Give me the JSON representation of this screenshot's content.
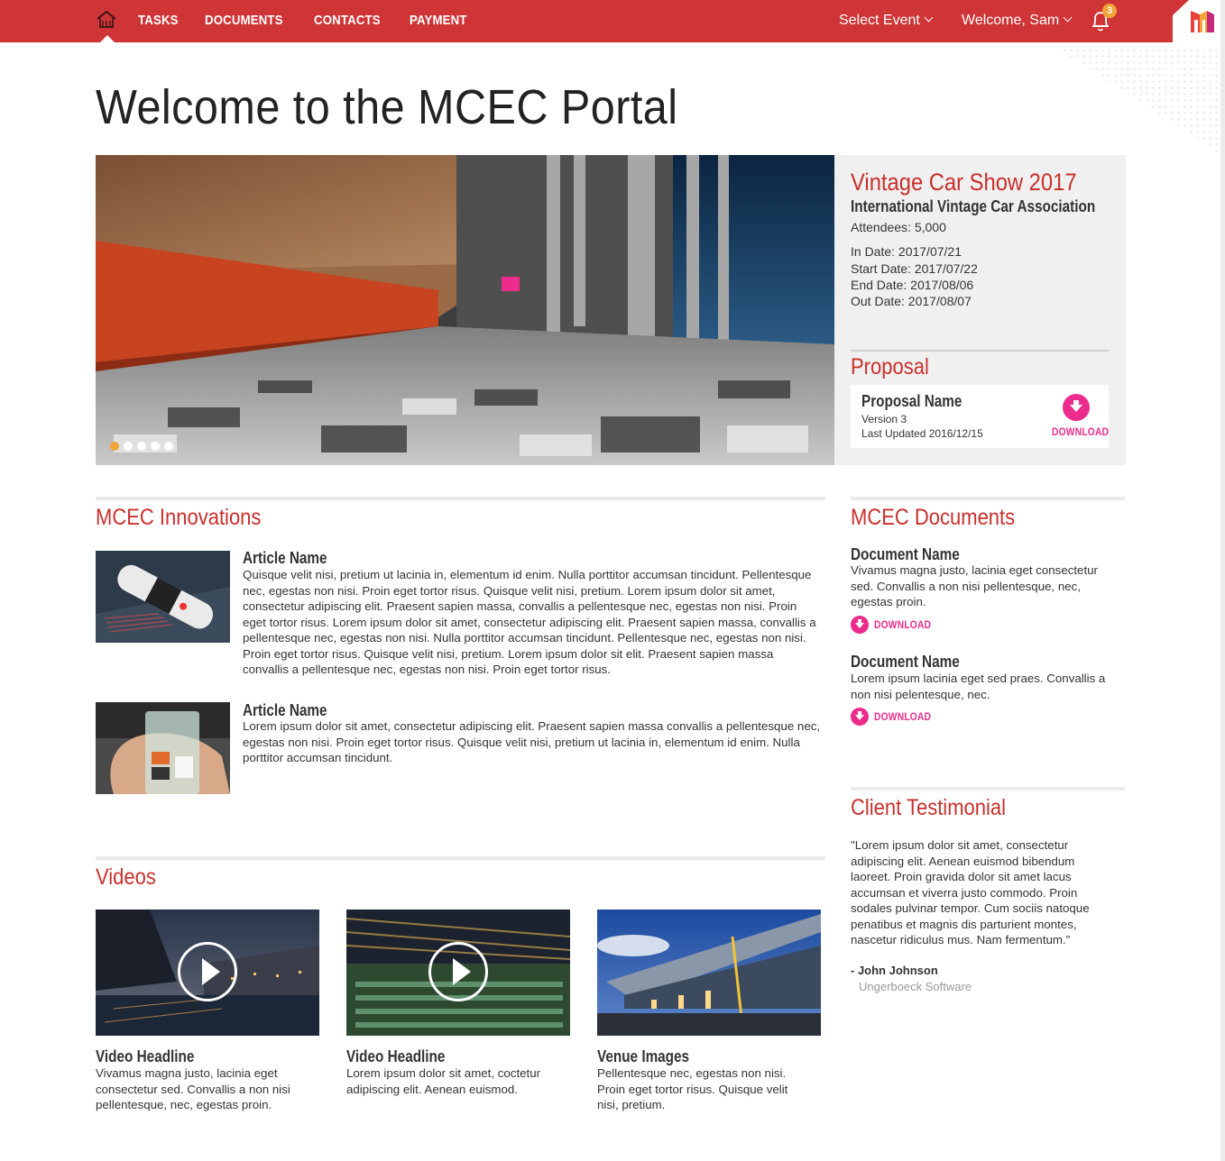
{
  "nav": {
    "items": [
      "TASKS",
      "DOCUMENTS",
      "CONTACTS",
      "PAYMENT"
    ],
    "select_event": "Select Event",
    "welcome": "Welcome, Sam",
    "notification_count": "3"
  },
  "page_title": "Welcome to the MCEC Portal",
  "hero": {
    "slide_count": 5,
    "active_slide": 1
  },
  "event": {
    "title": "Vintage Car Show 2017",
    "organization": "International Vintage Car Association",
    "attendees": "Attendees: 5,000",
    "in_date": "In Date: 2017/07/21",
    "start_date": "Start Date: 2017/07/22",
    "end_date": "End Date: 2017/08/06",
    "out_date": "Out Date: 2017/08/07"
  },
  "proposal": {
    "heading": "Proposal",
    "name": "Proposal Name",
    "version": "Version 3",
    "updated": "Last Updated 2016/12/15",
    "download": "DOWNLOAD"
  },
  "innovations": {
    "heading": "MCEC Innovations",
    "articles": [
      {
        "name": "Article Name",
        "text": "Quisque velit nisi, pretium ut lacinia in, elementum id enim. Nulla porttitor accumsan tincidunt. Pellentesque nec, egestas non nisi. Proin eget tortor risus. Quisque velit nisi, pretium. Lorem ipsum dolor sit amet, consectetur adipiscing elit. Praesent sapien massa, convallis a pellentesque nec, egestas non nisi. Proin eget tortor risus. Lorem ipsum dolor sit amet, consectetur adipiscing elit. Praesent sapien massa, convallis a pellentesque nec, egestas non nisi. Nulla porttitor accumsan tincidunt. Pellentesque nec, egestas non nisi. Proin eget tortor risus. Quisque velit nisi, pretium. Lorem ipsum dolor sit elit. Praesent sapien massa convallis a pellentesque nec, egestas non nisi. Proin eget tortor risus."
      },
      {
        "name": "Article Name",
        "text": "Lorem ipsum dolor sit amet, consectetur adipiscing elit. Praesent sapien massa convallis a pellentesque nec, egestas non nisi. Proin eget tortor risus. Quisque velit nisi, pretium ut lacinia in, elementum id enim. Nulla porttitor accumsan tincidunt."
      }
    ]
  },
  "documents": {
    "heading": "MCEC Documents",
    "items": [
      {
        "name": "Document Name",
        "text": "Vivamus magna justo, lacinia eget consectetur sed. Convallis a non nisi pellentesque, nec, egestas proin.",
        "download": "DOWNLOAD"
      },
      {
        "name": "Document Name",
        "text": "Lorem ipsum lacinia eget sed praes. Convallis a non nisi pelentesque, nec.",
        "download": "DOWNLOAD"
      }
    ]
  },
  "videos": {
    "heading": "Videos",
    "items": [
      {
        "headline": "Video Headline",
        "text": "Vivamus magna justo, lacinia eget consectetur sed. Convallis a non nisi pellentesque, nec, egestas proin."
      },
      {
        "headline": "Video Headline",
        "text": "Lorem ipsum dolor sit amet, coctetur adipiscing elit. Aenean euismod."
      },
      {
        "headline": "Venue Images",
        "text": "Pellentesque nec, egestas non nisi. Proin eget tortor risus. Quisque velit nisi, pretium."
      }
    ]
  },
  "testimonial": {
    "heading": "Client Testimonial",
    "quote": "\"Lorem ipsum dolor sit amet, consectetur adipiscing elit. Aenean euismod bibendum laoreet. Proin gravida dolor sit amet lacus accumsan et viverra justo commodo. Proin sodales pulvinar tempor. Cum sociis natoque penatibus et magnis dis parturient montes, nascetur ridiculus mus. Nam fermentum.\"",
    "author": "- John Johnson",
    "company": "Ungerboeck Software"
  },
  "colors": {
    "brand_red": "#cf3537",
    "heading_red": "#c9302c",
    "download_pink": "#ec2c8c",
    "badge_orange": "#f2a536"
  }
}
